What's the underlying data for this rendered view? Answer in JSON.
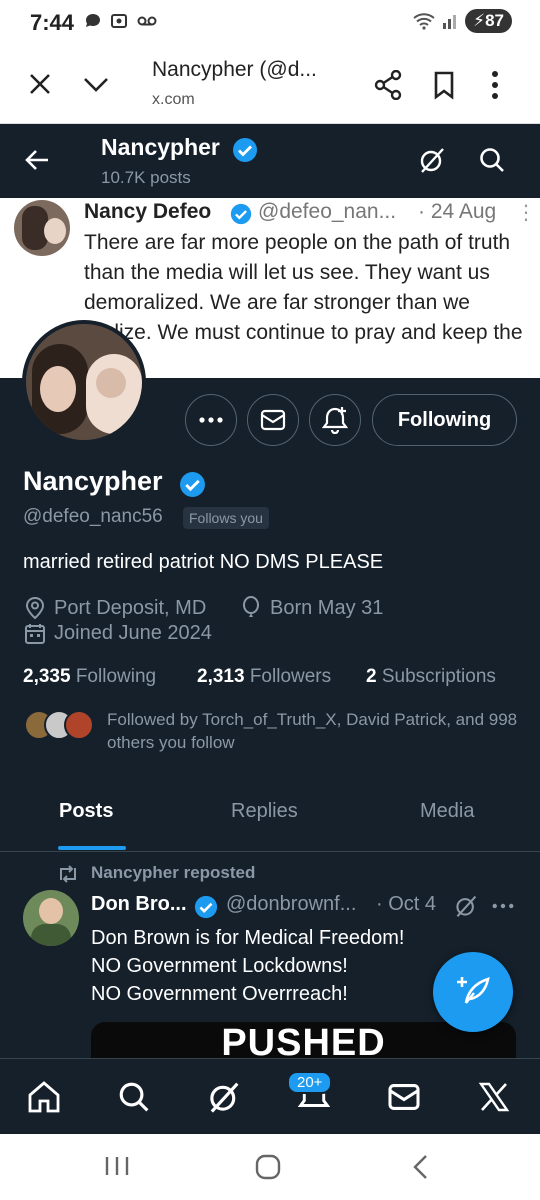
{
  "status_bar": {
    "time": "7:44",
    "battery": "87",
    "icons": [
      "chat-bubble-icon",
      "screenshot-icon",
      "voicemail-icon",
      "wifi-icon",
      "signal-icon"
    ]
  },
  "browser": {
    "title": "Nancypher (@d...",
    "domain": "x.com",
    "icons": [
      "close-icon",
      "chevron-down-icon",
      "share-icon",
      "bookmark-icon",
      "more-vertical-icon"
    ]
  },
  "header": {
    "name": "Nancypher",
    "posts_count": "10.7K posts"
  },
  "banner_quote": {
    "name": "Nancy Defeo",
    "handle": "@defeo_nan...",
    "date": "· 24 Aug",
    "text": "There are far more people on the path of truth than the media will let us see. They want us demoralized.  We are far stronger than we realize.  We must continue to pray and keep the faith."
  },
  "actions": {
    "following_label": "Following"
  },
  "profile": {
    "name": "Nancypher",
    "handle": "@defeo_nanc56",
    "follows_you": "Follows you",
    "bio": "married retired patriot NO DMS PLEASE",
    "location": "Port Deposit, MD",
    "born": "Born May 31",
    "joined": "Joined June 2024",
    "following_count": "2,335",
    "following_label": "Following",
    "followers_count": "2,313",
    "followers_label": "Followers",
    "subscriptions_count": "2",
    "subscriptions_label": "Subscriptions",
    "followed_by": "Followed by Torch_of_Truth_X, David Patrick, and 998 others you follow"
  },
  "tabs": [
    "Posts",
    "Replies",
    "Media"
  ],
  "post": {
    "repost_label": "Nancypher reposted",
    "author_name": "Don Bro...",
    "author_handle": "@donbrownf...",
    "date": "· Oct 4",
    "lines": [
      "Don Brown is for Medical Freedom!",
      "NO Government Lockdowns!",
      "NO Government Overrreach!"
    ],
    "media_text": "PUSHED"
  },
  "bottom_nav": {
    "notifications_badge": "20+"
  },
  "colors": {
    "background": "#15202b",
    "accent": "#1d9bf0",
    "muted_text": "#8b98a5",
    "border": "#38444d"
  }
}
